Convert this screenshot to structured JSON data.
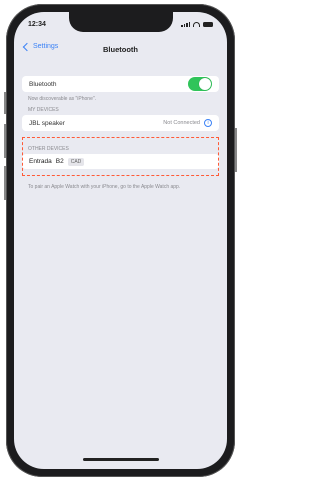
{
  "status_bar": {
    "time": "12:34"
  },
  "nav": {
    "back_label": "Settings",
    "title": "Bluetooth"
  },
  "bluetooth_row": {
    "label": "Bluetooth"
  },
  "caption_discoverable": "Now discoverable as \"iPhone\".",
  "my_devices_header": "MY DEVICES",
  "my_devices": [
    {
      "name": "JBL speaker",
      "status": "Not Connected"
    }
  ],
  "other_devices_header": "OTHER DEVICES",
  "other_devices": [
    {
      "name": "Entrada",
      "badge1": "B2",
      "badge2": "CAD"
    }
  ],
  "caption_pair": "To pair an Apple Watch with your iPhone, go to the Apple Watch app.",
  "colors": {
    "accent": "#3b82f6",
    "toggle_on": "#30c45a",
    "highlight": "#ff5a36"
  }
}
